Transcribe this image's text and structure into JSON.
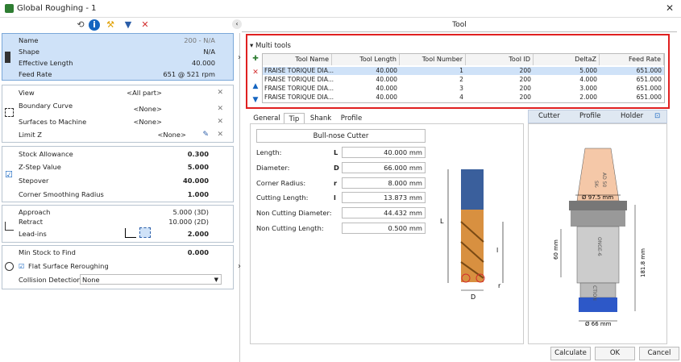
{
  "window": {
    "title": "Global Roughing - 1",
    "close": "✕"
  },
  "left": {
    "tool": {
      "name_label": "Name",
      "name_value": "200 - N/A",
      "shape_label": "Shape",
      "shape_value": "N/A",
      "eff_label": "Effective Length",
      "eff_value": "40.000",
      "feed_label": "Feed Rate",
      "feed_value": "651 @ 521 rpm"
    },
    "boundary": {
      "view_label": "View",
      "view_value": "<All part>",
      "bc_label": "Boundary Curve",
      "bc_value": "<None>",
      "stm_label": "Surfaces to Machine",
      "stm_value": "<None>",
      "lz_label": "Limit Z",
      "lz_value": "<None>"
    },
    "params": {
      "sa_label": "Stock Allowance",
      "sa_value": "0.300",
      "zs_label": "Z-Step Value",
      "zs_value": "5.000",
      "so_label": "Stepover",
      "so_value": "40.000",
      "cs_label": "Corner Smoothing Radius",
      "cs_value": "1.000"
    },
    "links": {
      "ap_label": "Approach",
      "ap_value": "5.000 (3D)",
      "re_label": "Retract",
      "re_value": "10.000 (2D)",
      "li_label": "Lead-ins",
      "li_value": "2.000"
    },
    "misc": {
      "ms_label": "Min Stock to Find",
      "ms_value": "0.000",
      "fs_label": "Flat Surface Reroughing",
      "cd_label": "Collision Detection",
      "cd_value": "None"
    }
  },
  "right": {
    "title": "Tool",
    "multi_tools": "Multi tools",
    "columns": [
      "Tool Name",
      "Tool Length",
      "Tool Number",
      "Tool ID",
      "DeltaZ",
      "Feed Rate"
    ],
    "rows": [
      [
        "FRAISE TORIQUE DIA...",
        "40.000",
        "1",
        "200",
        "5.000",
        "651.000"
      ],
      [
        "FRAISE TORIQUE DIA...",
        "40.000",
        "2",
        "200",
        "4.000",
        "651.000"
      ],
      [
        "FRAISE TORIQUE DIA...",
        "40.000",
        "3",
        "200",
        "3.000",
        "651.000"
      ],
      [
        "FRAISE TORIQUE DIA...",
        "40.000",
        "4",
        "200",
        "2.000",
        "651.000"
      ]
    ],
    "tabs": [
      "General",
      "Tip",
      "Shank",
      "Profile"
    ],
    "cutter_type": "Bull-nose Cutter",
    "props": [
      {
        "label": "Length:",
        "sym": "L",
        "value": "40.000 mm"
      },
      {
        "label": "Diameter:",
        "sym": "D",
        "value": "66.000 mm"
      },
      {
        "label": "Corner Radius:",
        "sym": "r",
        "value": "8.000 mm"
      },
      {
        "label": "Cutting Length:",
        "sym": "l",
        "value": "13.873 mm"
      },
      {
        "label": "Non Cutting Diameter:",
        "sym": "",
        "value": "44.432 mm"
      },
      {
        "label": "Non Cutting Length:",
        "sym": "",
        "value": "0.500 mm"
      }
    ],
    "diagram_labels": {
      "L": "L",
      "l": "l",
      "r": "r",
      "D": "D"
    },
    "view_tabs": [
      "Cutter",
      "Profile",
      "Holder"
    ],
    "holder_labels": {
      "d1": "Ø 97.5 mm",
      "h1": "60 mm",
      "h2": "181.8 mm",
      "d2": "Ø 66 mm",
      "t1": "SK-",
      "t2": "AD 50",
      "t3": "ONGE-6",
      "t4": "CTION"
    },
    "buttons": {
      "calc": "Calculate",
      "ok": "OK",
      "cancel": "Cancel"
    }
  }
}
